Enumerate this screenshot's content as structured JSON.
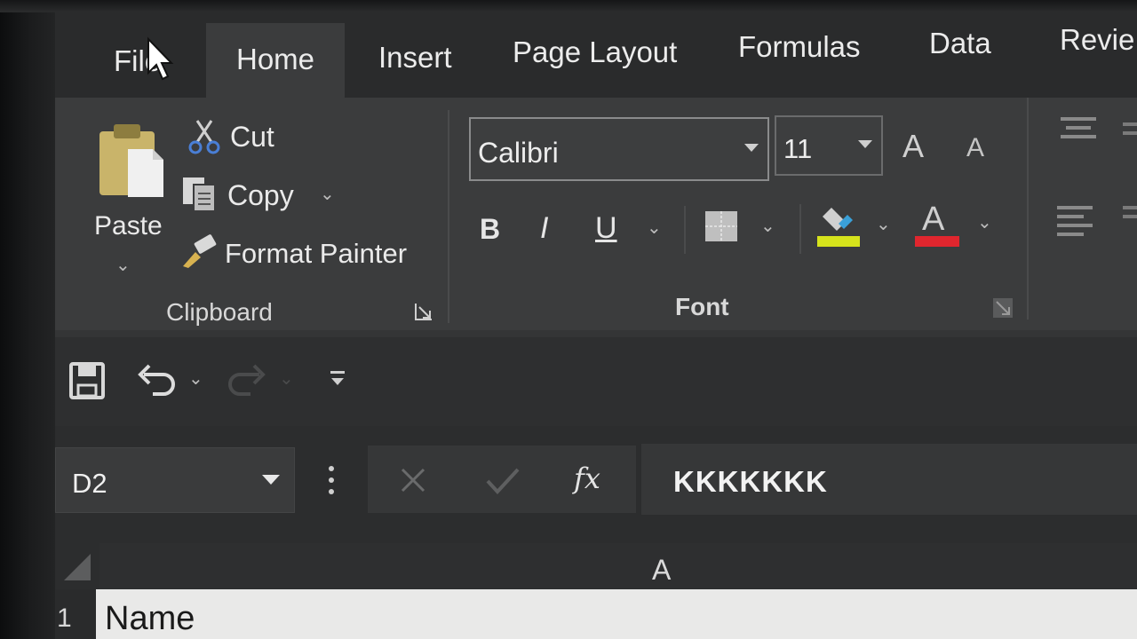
{
  "tabs": {
    "file": "File",
    "home": "Home",
    "insert": "Insert",
    "page_layout": "Page Layout",
    "formulas": "Formulas",
    "data": "Data",
    "review": "Revie"
  },
  "clipboard": {
    "paste": "Paste",
    "cut": "Cut",
    "copy": "Copy",
    "format_painter": "Format Painter",
    "group_label": "Clipboard"
  },
  "font": {
    "family": "Calibri",
    "size": "11",
    "bold": "B",
    "italic": "I",
    "underline": "U",
    "grow": "A",
    "shrink": "A",
    "color_letter": "A",
    "group_label": "Font"
  },
  "formula_bar": {
    "name_box": "D2",
    "fx": "fx",
    "content": "KKKKKKK"
  },
  "grid": {
    "column_a": "A",
    "row_1": "1",
    "cell_a1": "Name"
  },
  "colors": {
    "highlight_bar": "#d6e31c",
    "font_color_bar": "#e0262e",
    "paste_clipboard": "#c9b46a",
    "cut_blue": "#4a7fd6"
  },
  "icons": [
    "mouse-pointer-icon",
    "paste-icon",
    "scissors-icon",
    "copy-icon",
    "format-painter-icon",
    "dialog-launcher-icon",
    "border-icon",
    "highlight-icon",
    "save-icon",
    "undo-icon",
    "redo-icon",
    "customize-qat-icon",
    "cancel-icon",
    "enter-icon",
    "select-all-icon",
    "align-icon"
  ]
}
